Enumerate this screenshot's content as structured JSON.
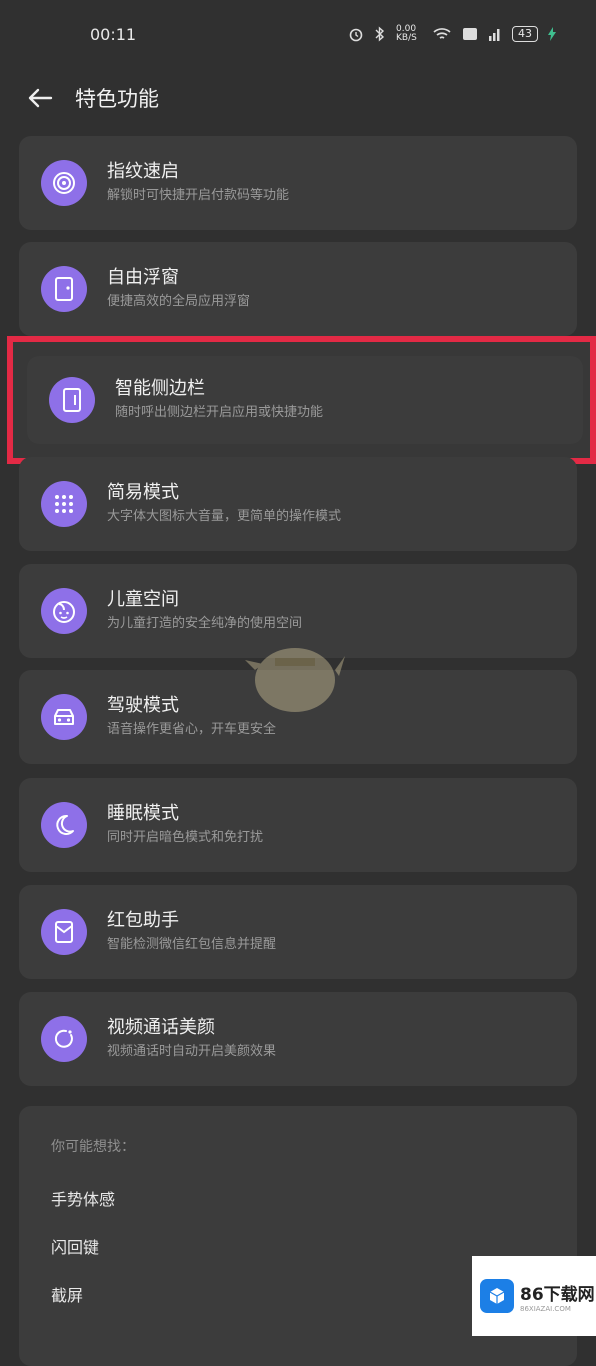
{
  "status": {
    "time": "00:11",
    "net_speed": "0.00 KB/S",
    "battery": "43"
  },
  "header": {
    "title": "特色功能"
  },
  "features": [
    {
      "title": "指纹速启",
      "subtitle": "解锁时可快捷开启付款码等功能",
      "icon": "fingerprint-icon"
    },
    {
      "title": "自由浮窗",
      "subtitle": "便捷高效的全局应用浮窗",
      "icon": "floating-window-icon"
    },
    {
      "title": "智能侧边栏",
      "subtitle": "随时呼出侧边栏开启应用或快捷功能",
      "icon": "sidebar-icon"
    },
    {
      "title": "简易模式",
      "subtitle": "大字体大图标大音量，更简单的操作模式",
      "icon": "grid-icon"
    },
    {
      "title": "儿童空间",
      "subtitle": "为儿童打造的安全纯净的使用空间",
      "icon": "child-face-icon"
    },
    {
      "title": "驾驶模式",
      "subtitle": "语音操作更省心，开车更安全",
      "icon": "car-icon"
    },
    {
      "title": "睡眠模式",
      "subtitle": "同时开启暗色模式和免打扰",
      "icon": "moon-icon"
    },
    {
      "title": "红包助手",
      "subtitle": "智能检测微信红包信息并提醒",
      "icon": "red-packet-icon"
    },
    {
      "title": "视频通话美颜",
      "subtitle": "视频通话时自动开启美颜效果",
      "icon": "beauty-icon"
    }
  ],
  "suggestions": {
    "title": "你可能想找：",
    "items": [
      "手势体感",
      "闪回键",
      "截屏"
    ]
  },
  "logo": {
    "text": "86下载网",
    "sub": "86XIAZAI.COM"
  },
  "colors": {
    "accent": "#8e70e8",
    "highlight_border": "#e32a45"
  }
}
